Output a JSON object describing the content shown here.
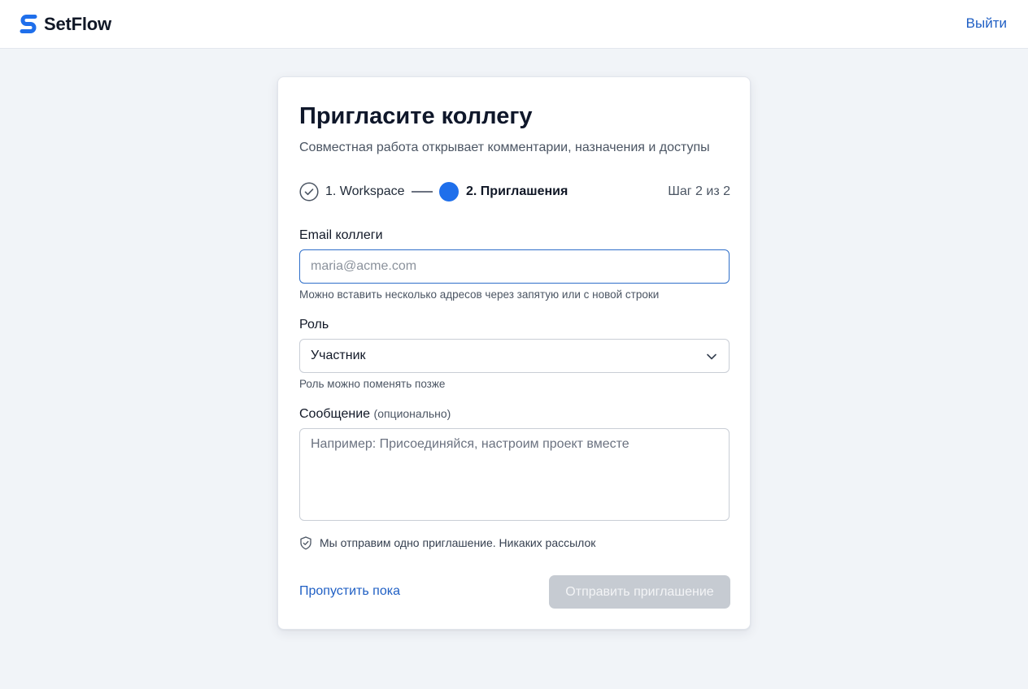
{
  "app": {
    "name": "SetFlow",
    "logo_icon": "setflow-logo-icon",
    "brand_color": "#1f6feb"
  },
  "header": {
    "logout_label": "Выйти"
  },
  "card": {
    "title": "Пригласите коллегу",
    "subtitle": "Совместная работа открывает комментарии, назначения и доступы"
  },
  "stepper": {
    "steps": [
      {
        "label": "1. Workspace",
        "state": "done",
        "icon": "check-circle-icon"
      },
      {
        "label": "2. Приглашения",
        "state": "active"
      }
    ],
    "counter": "Шаг 2 из 2"
  },
  "email": {
    "label": "Email коллеги",
    "placeholder": "maria@acme.com",
    "value": "",
    "hint": "Можно вставить несколько адресов через запятую или с новой строки"
  },
  "role": {
    "label": "Роль",
    "selected": "Участник",
    "hint": "Роль можно поменять позже"
  },
  "message": {
    "label": "Сообщение",
    "optional_label": "(опционально)",
    "placeholder": "Например: Присоединяйся, настроим проект вместе",
    "value": ""
  },
  "privacy_note": {
    "icon": "shield-check-icon",
    "text": "Мы отправим одно приглашение. Никаких рассылок"
  },
  "actions": {
    "skip_label": "Пропустить пока",
    "send_label": "Отправить приглашение",
    "send_disabled": true
  },
  "colors": {
    "link": "#1f5fc4",
    "active_step": "#1f6feb",
    "disabled_button": "#c6cbd2"
  }
}
